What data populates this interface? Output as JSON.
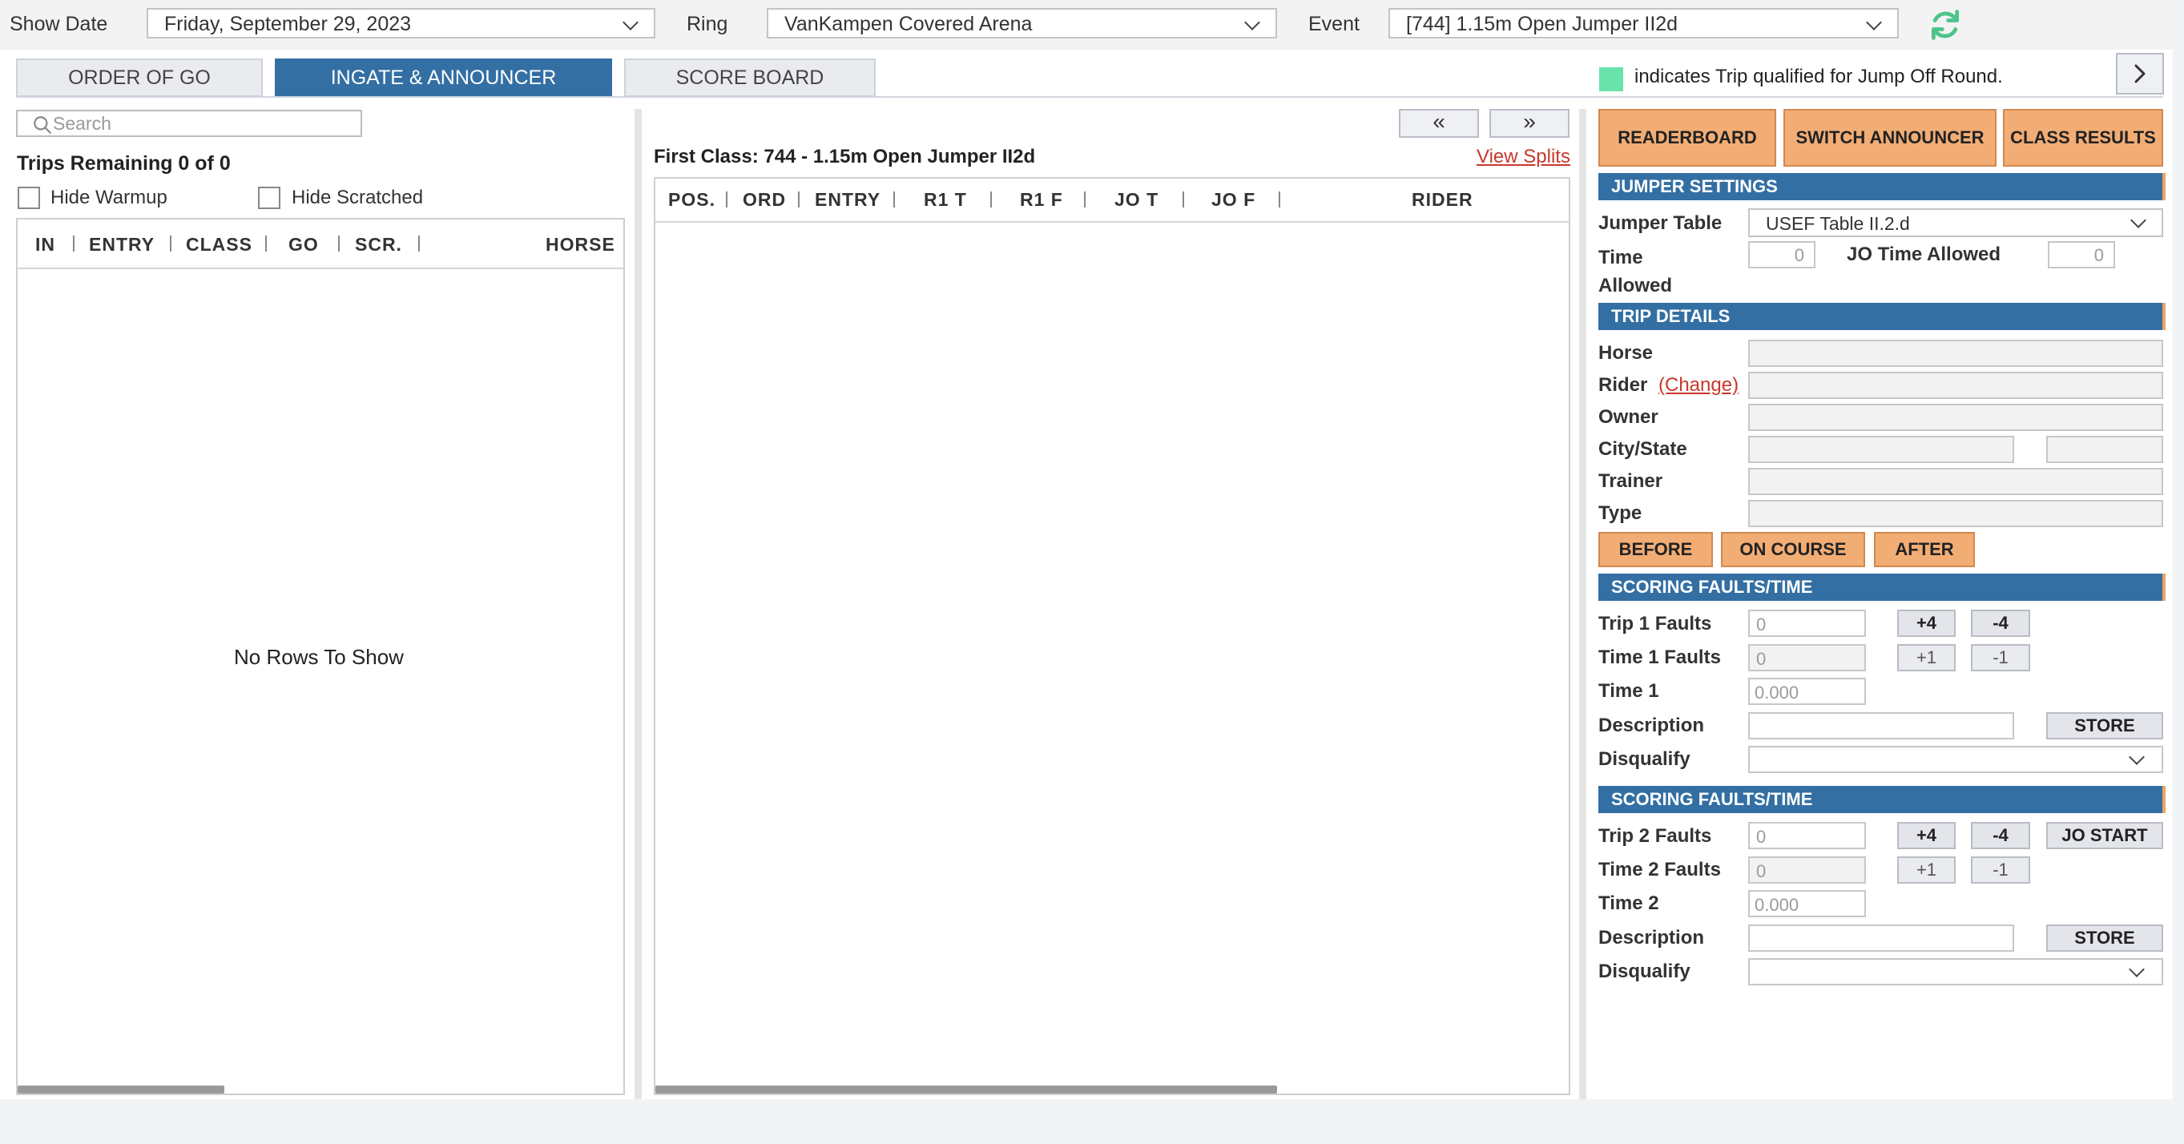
{
  "topbar": {
    "show_date_label": "Show Date",
    "show_date_value": "Friday, September 29, 2023",
    "ring_label": "Ring",
    "ring_value": "VanKampen Covered Arena",
    "event_label": "Event",
    "event_value": "[744] 1.15m Open Jumper II2d"
  },
  "tabs": [
    {
      "label": "ORDER OF GO",
      "active": false
    },
    {
      "label": "INGATE & ANNOUNCER",
      "active": true
    },
    {
      "label": "SCORE BOARD",
      "active": false
    }
  ],
  "legend": {
    "text": "indicates Trip qualified for Jump Off Round.",
    "color": "#69e3ab"
  },
  "left": {
    "search_placeholder": "Search",
    "trips_remaining": "Trips Remaining 0 of 0",
    "hide_warmup": "Hide Warmup",
    "hide_scratched": "Hide Scratched",
    "columns": [
      "IN",
      "ENTRY",
      "CLASS",
      "GO",
      "SCR.",
      "HORSE"
    ],
    "empty_text": "No Rows To Show"
  },
  "middle": {
    "prev_label": "«",
    "next_label": "»",
    "first_class": "First Class: 744 - 1.15m Open Jumper II2d",
    "view_splits": "View Splits",
    "columns": [
      "POS.",
      "ORD",
      "ENTRY",
      "R1 T",
      "R1 F",
      "JO T",
      "JO F",
      "RIDER"
    ]
  },
  "right": {
    "buttons": {
      "readerboard": "READERBOARD",
      "switch_announcer": "SWITCH ANNOUNCER",
      "class_results": "CLASS RESULTS"
    },
    "jumper_settings": {
      "title": "JUMPER SETTINGS",
      "table_label": "Jumper Table",
      "table_value": "USEF Table II.2.d",
      "time_allowed_label": "Time Allowed",
      "time_allowed_value": "0",
      "jo_time_label": "JO Time Allowed",
      "jo_time_value": "0"
    },
    "trip_details": {
      "title": "TRIP DETAILS",
      "horse": "Horse",
      "rider": "Rider",
      "change": "(Change)",
      "owner": "Owner",
      "city_state": "City/State",
      "trainer": "Trainer",
      "type": "Type"
    },
    "status_buttons": {
      "before": "BEFORE",
      "on_course": "ON COURSE",
      "after": "AFTER"
    },
    "scoring1": {
      "title": "SCORING FAULTS/TIME",
      "trip_faults": "Trip 1 Faults",
      "trip_faults_ph": "0",
      "time_faults": "Time 1 Faults",
      "time_faults_ph": "0",
      "time": "Time 1",
      "time_ph": "0.000",
      "description": "Description",
      "disqualify": "Disqualify",
      "plus4": "+4",
      "minus4": "-4",
      "plus1": "+1",
      "minus1": "-1",
      "store": "STORE"
    },
    "scoring2": {
      "title": "SCORING FAULTS/TIME",
      "trip_faults": "Trip 2 Faults",
      "trip_faults_ph": "0",
      "time_faults": "Time 2 Faults",
      "time_faults_ph": "0",
      "time": "Time 2",
      "time_ph": "0.000",
      "description": "Description",
      "disqualify": "Disqualify",
      "plus4": "+4",
      "minus4": "-4",
      "plus1": "+1",
      "minus1": "-1",
      "store": "STORE",
      "jo_start": "JO START"
    }
  },
  "icons": {
    "refresh": "refresh-icon",
    "search": "search-icon",
    "next": "chevron-right-icon"
  },
  "colors": {
    "primary": "#336fa3",
    "accent": "#f2ad75",
    "link": "#c8382c",
    "qualified": "#69e3ab"
  }
}
